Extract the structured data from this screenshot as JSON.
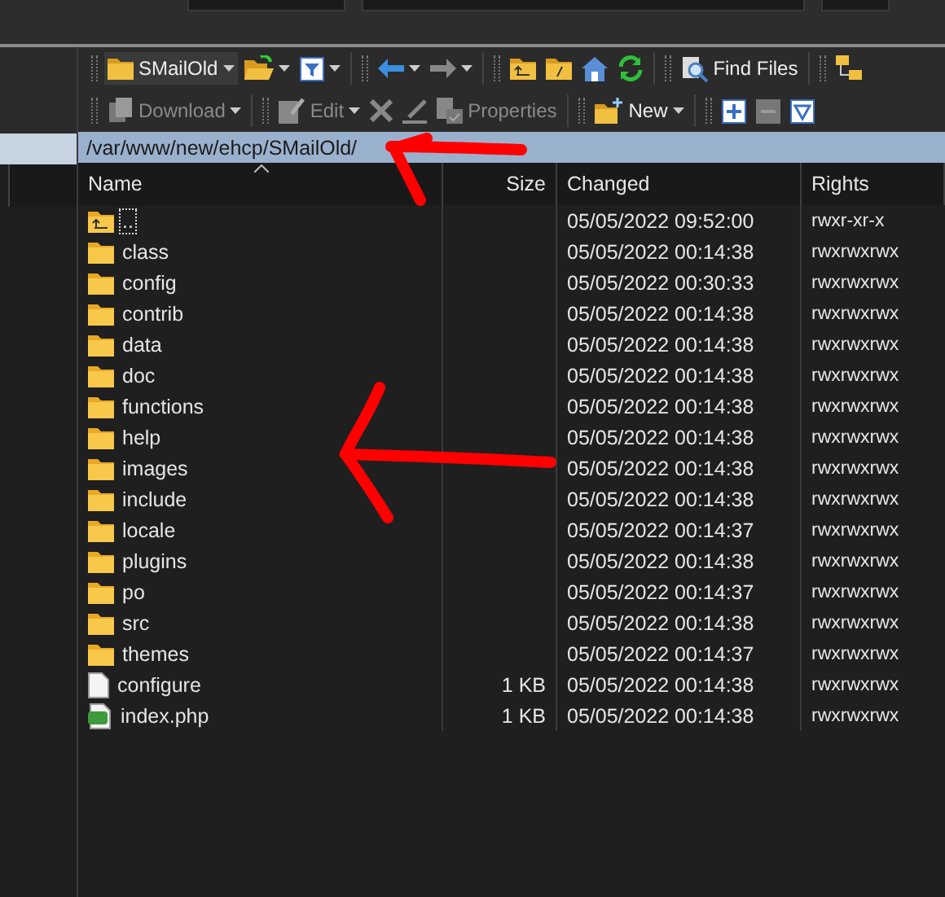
{
  "location": {
    "label": "SMailOld"
  },
  "toolbar_1": [
    {
      "kind": "open-folder",
      "caret": true
    },
    {
      "kind": "filter",
      "caret": true
    },
    {
      "kind": "back",
      "caret": true
    },
    {
      "kind": "forward",
      "caret": true
    },
    {
      "kind": "parent"
    },
    {
      "kind": "root"
    },
    {
      "kind": "home"
    },
    {
      "kind": "refresh"
    },
    {
      "kind": "find",
      "label": "Find Files"
    },
    {
      "kind": "tree"
    }
  ],
  "toolbar_2": [
    {
      "kind": "download",
      "label": "Download",
      "disabled": true,
      "caret": true
    },
    {
      "kind": "edit",
      "label": "Edit",
      "disabled": true,
      "caret": true
    },
    {
      "kind": "delete",
      "disabled": true
    },
    {
      "kind": "rename",
      "disabled": true
    },
    {
      "kind": "properties",
      "label": "Properties",
      "disabled": true
    },
    {
      "kind": "new",
      "label": "New",
      "disabled": false,
      "caret": true
    },
    {
      "kind": "plus",
      "disabled": false
    },
    {
      "kind": "minus",
      "disabled": true
    },
    {
      "kind": "check",
      "disabled": false
    }
  ],
  "path": "/var/www/new/ehcp/SMailOld/",
  "columns": [
    "Name",
    "Size",
    "Changed",
    "Rights"
  ],
  "rows": [
    {
      "kind": "parent",
      "name": "..",
      "size": "",
      "changed": "05/05/2022 09:52:00",
      "rights": "rwxr-xr-x",
      "focused": true
    },
    {
      "kind": "folder",
      "name": "class",
      "changed": "05/05/2022 00:14:38",
      "rights": "rwxrwxrwx",
      "focused": false
    },
    {
      "kind": "folder",
      "name": "config",
      "changed": "05/05/2022 00:30:33",
      "rights": "rwxrwxrwx",
      "focused": false
    },
    {
      "kind": "folder",
      "name": "contrib",
      "changed": "05/05/2022 00:14:38",
      "rights": "rwxrwxrwx",
      "focused": false
    },
    {
      "kind": "folder",
      "name": "data",
      "changed": "05/05/2022 00:14:38",
      "rights": "rwxrwxrwx",
      "focused": false
    },
    {
      "kind": "folder",
      "name": "doc",
      "changed": "05/05/2022 00:14:38",
      "rights": "rwxrwxrwx",
      "focused": false
    },
    {
      "kind": "folder",
      "name": "functions",
      "changed": "05/05/2022 00:14:38",
      "rights": "rwxrwxrwx",
      "focused": false
    },
    {
      "kind": "folder",
      "name": "help",
      "changed": "05/05/2022 00:14:38",
      "rights": "rwxrwxrwx",
      "focused": false
    },
    {
      "kind": "folder",
      "name": "images",
      "changed": "05/05/2022 00:14:38",
      "rights": "rwxrwxrwx",
      "focused": false
    },
    {
      "kind": "folder",
      "name": "include",
      "changed": "05/05/2022 00:14:38",
      "rights": "rwxrwxrwx",
      "focused": false
    },
    {
      "kind": "folder",
      "name": "locale",
      "changed": "05/05/2022 00:14:37",
      "rights": "rwxrwxrwx",
      "focused": false
    },
    {
      "kind": "folder",
      "name": "plugins",
      "changed": "05/05/2022 00:14:38",
      "rights": "rwxrwxrwx",
      "focused": false
    },
    {
      "kind": "folder",
      "name": "po",
      "changed": "05/05/2022 00:14:37",
      "rights": "rwxrwxrwx",
      "focused": false
    },
    {
      "kind": "folder",
      "name": "src",
      "changed": "05/05/2022 00:14:38",
      "rights": "rwxrwxrwx",
      "focused": false
    },
    {
      "kind": "folder",
      "name": "themes",
      "changed": "05/05/2022 00:14:37",
      "rights": "rwxrwxrwx",
      "focused": false
    },
    {
      "kind": "file",
      "name": "configure",
      "size": "1 KB",
      "changed": "05/05/2022 00:14:38",
      "rights": "rwxrwxrwx",
      "focused": false
    },
    {
      "kind": "php",
      "name": "index.php",
      "size": "1 KB",
      "changed": "05/05/2022 00:14:38",
      "rights": "rwxrwxrwx",
      "focused": false
    }
  ]
}
